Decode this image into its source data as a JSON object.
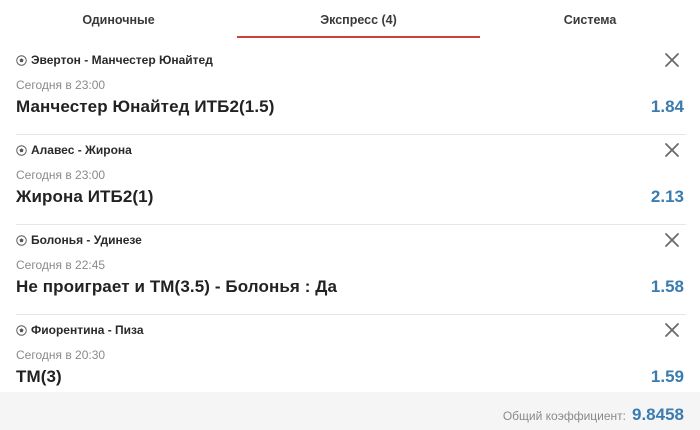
{
  "tabs": [
    {
      "label": "Одиночные",
      "active": false
    },
    {
      "label": "Экспресс (4)",
      "active": true
    },
    {
      "label": "Система",
      "active": false
    }
  ],
  "accent_color": "#c8443a",
  "odds_color": "#3a7bb0",
  "bets": [
    {
      "sport_icon": "soccer-ball-icon",
      "match": "Эвертон - Манчестер Юнайтед",
      "time": "Сегодня в 23:00",
      "selection": "Манчестер Юнайтед ИТБ2(1.5)",
      "odds": "1.84"
    },
    {
      "sport_icon": "soccer-ball-icon",
      "match": "Алавес - Жирона",
      "time": "Сегодня в 23:00",
      "selection": "Жирона ИТБ2(1)",
      "odds": "2.13"
    },
    {
      "sport_icon": "soccer-ball-icon",
      "match": "Болонья - Удинезе",
      "time": "Сегодня в 22:45",
      "selection": "Не проиграет и ТМ(3.5) - Болонья : Да",
      "odds": "1.58"
    },
    {
      "sport_icon": "soccer-ball-icon",
      "match": "Фиорентина - Пиза",
      "time": "Сегодня в 20:30",
      "selection": "ТМ(3)",
      "odds": "1.59"
    }
  ],
  "footer": {
    "label": "Общий коэффициент:",
    "value": "9.8458"
  }
}
